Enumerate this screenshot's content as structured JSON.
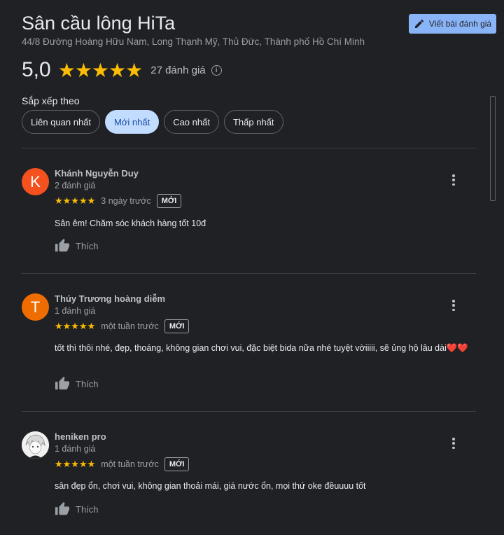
{
  "place": {
    "title": "Sân cầu lông HiTa",
    "address": "44/8 Đường Hoàng Hữu Nam, Long Thạnh Mỹ, Thủ Đức, Thành phố Hồ Chí Minh",
    "write_review_label": "Viết bài đánh giá"
  },
  "rating": {
    "value": "5,0",
    "stars": "★★★★★",
    "count_label": "27 đánh giá",
    "info_icon": "i"
  },
  "sort": {
    "label": "Sắp xếp theo",
    "options": [
      "Liên quan nhất",
      "Mới nhất",
      "Cao nhất",
      "Thấp nhất"
    ],
    "selected": "Mới nhất"
  },
  "colors": {
    "background": "#202124",
    "accent": "#8ab4f8",
    "star": "#fbbc04",
    "chip_selected": "#c2dcff"
  },
  "reviews": [
    {
      "initial": "K",
      "avatar_color": "#f4511e",
      "name": "Khánh Nguyễn Duy",
      "review_count": "2 đánh giá",
      "stars": "★★★★★",
      "time": "3 ngày trước",
      "badge": "MỚI",
      "text": "Sân êm! Chăm sóc khách hàng tốt 10đ",
      "like_label": "Thích"
    },
    {
      "initial": "T",
      "avatar_color": "#ef6c00",
      "name": "Thúy Trương hoàng diễm",
      "review_count": "1 đánh giá",
      "stars": "★★★★★",
      "time": "một tuần trước",
      "badge": "MỚI",
      "text": "tốt thì thôi nhé, đẹp, thoáng, không gian chơi vui, đặc biệt bida nữa nhé tuyệt vờiiiii, sẽ ủng hộ lâu dài❤️❤️",
      "like_label": "Thích"
    },
    {
      "initial": "",
      "avatar_color": "#e8e8e8",
      "name": "heniken pro",
      "review_count": "1 đánh giá",
      "stars": "★★★★★",
      "time": "một tuần trước",
      "badge": "MỚI",
      "text": "sân đẹp ổn, chơi vui, không gian thoải mái, giá nước ổn, mọi thứ oke đềuuuu tốt",
      "like_label": "Thích"
    }
  ]
}
